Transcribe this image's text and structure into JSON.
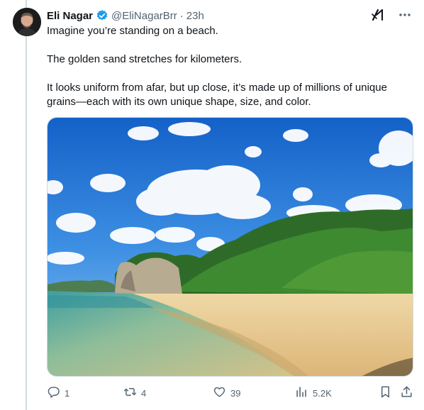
{
  "author": {
    "name": "Eli Nagar",
    "handle": "@EliNagarBrr",
    "separator": "·",
    "time": "23h",
    "verified": true
  },
  "tweet": {
    "lines": [
      "Imagine you’re standing on a beach.",
      "The golden sand stretches for kilometers.",
      "It looks uniform from afar, but up close, it’s made up of millions of unique grains—each with its own unique shape, size, and color."
    ]
  },
  "media": {
    "type": "photo",
    "subject": "beach-with-clouds-and-forested-headland"
  },
  "actions": {
    "replies": "1",
    "reposts": "4",
    "likes": "39",
    "views": "5.2K"
  },
  "icons": {
    "grok": "grok-icon",
    "more": "more-icon",
    "reply": "reply-icon",
    "repost": "repost-icon",
    "like": "like-icon",
    "views": "views-icon",
    "bookmark": "bookmark-icon",
    "share": "share-icon"
  },
  "colors": {
    "verified": "#1d9bf0",
    "muted": "#536471",
    "text": "#0f1419"
  }
}
